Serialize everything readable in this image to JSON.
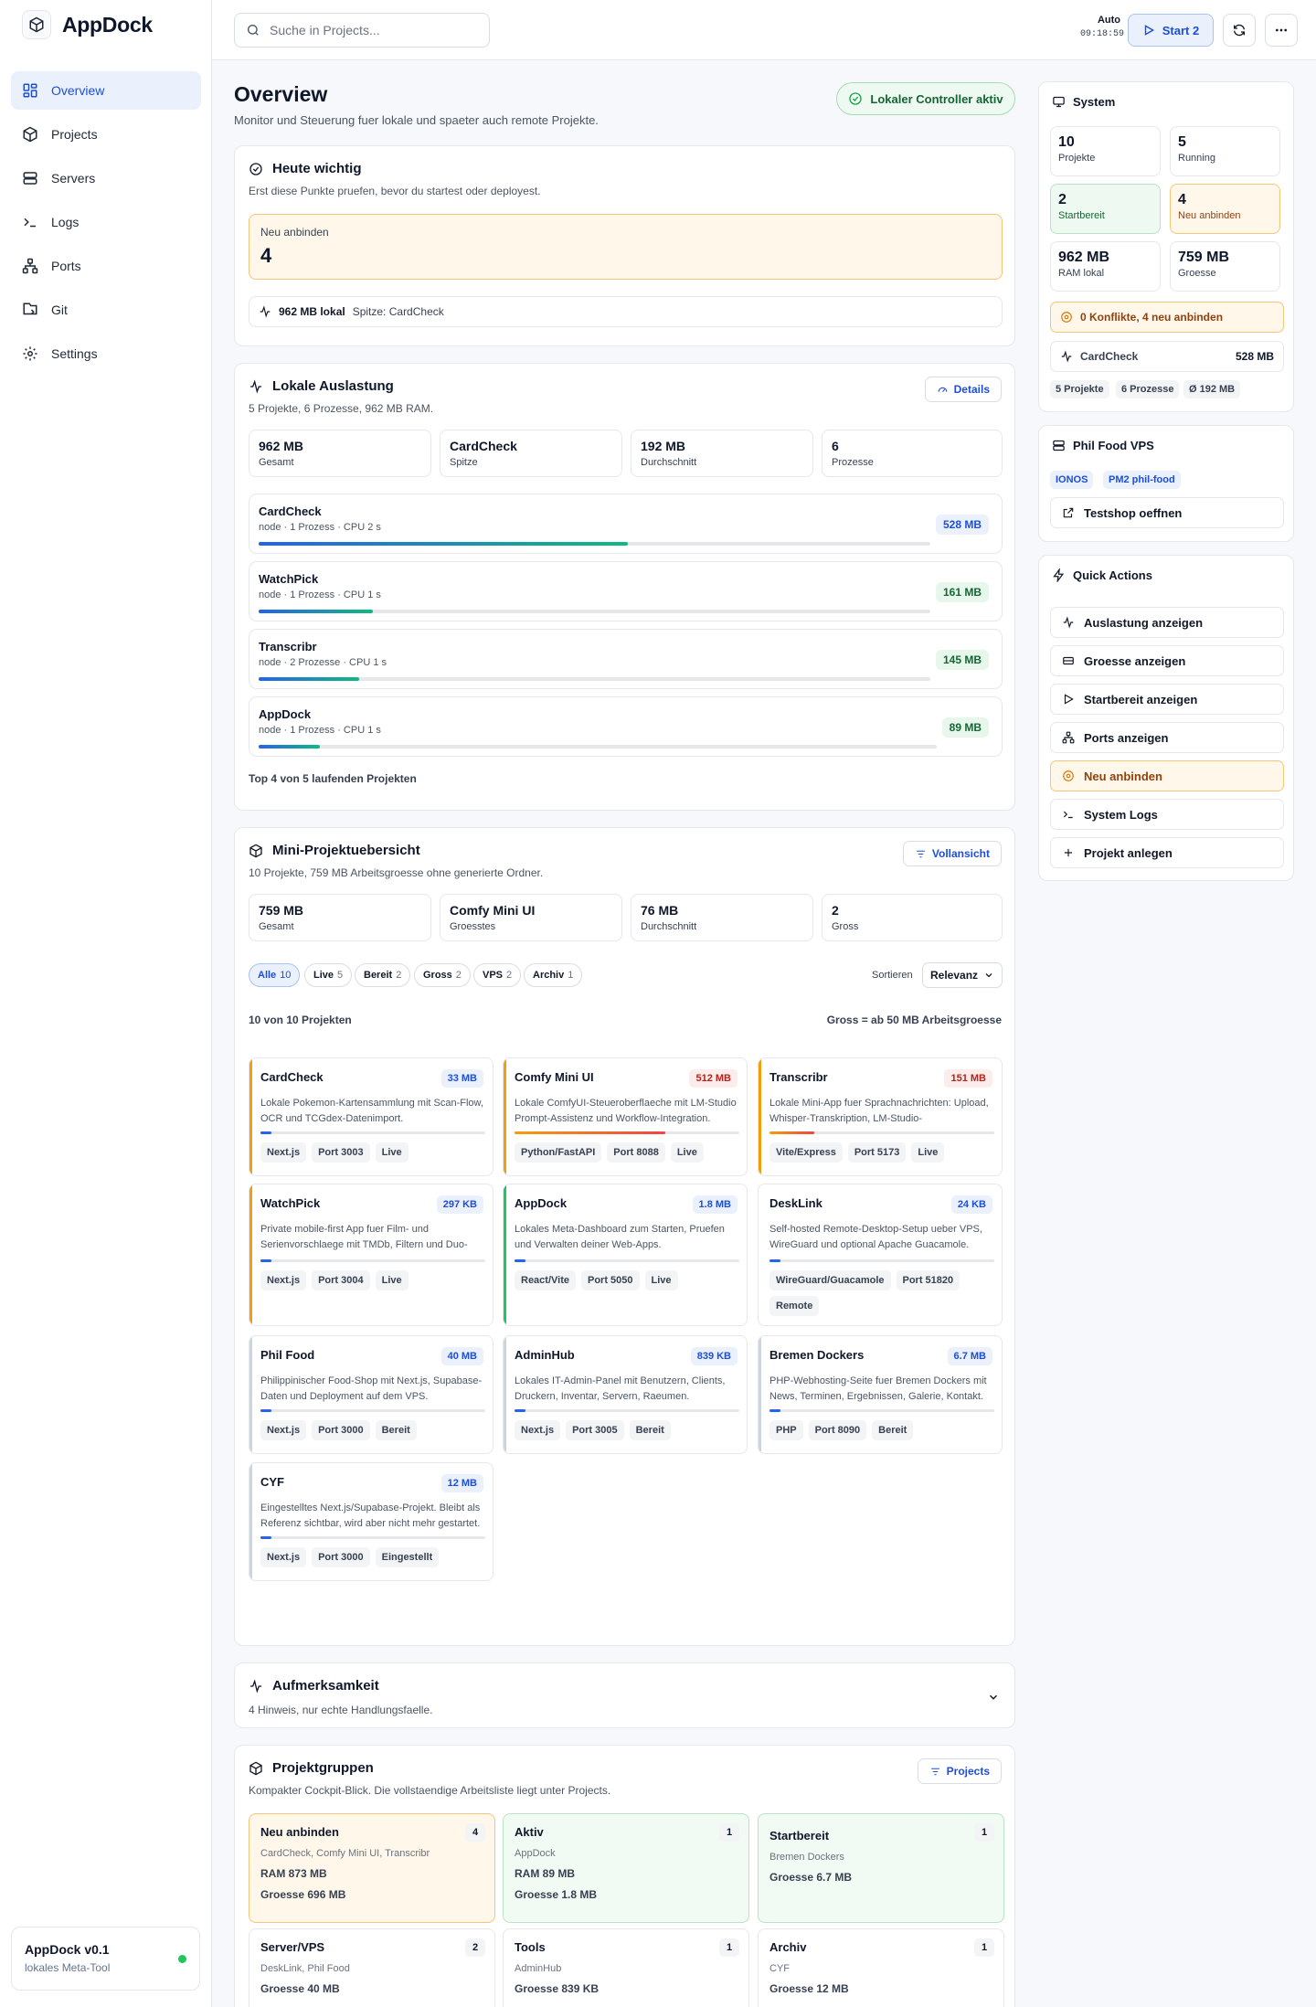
{
  "app": {
    "name": "AppDock",
    "version": "AppDock v0.1",
    "tagline": "lokales Meta-Tool"
  },
  "nav": [
    {
      "label": "Overview",
      "icon": "grid-icon",
      "active": true
    },
    {
      "label": "Projects",
      "icon": "cube-icon"
    },
    {
      "label": "Servers",
      "icon": "server-icon"
    },
    {
      "label": "Logs",
      "icon": "terminal-icon"
    },
    {
      "label": "Ports",
      "icon": "network-icon"
    },
    {
      "label": "Git",
      "icon": "git-icon"
    },
    {
      "label": "Settings",
      "icon": "gear-icon"
    }
  ],
  "topbar": {
    "search_placeholder": "Suche in Projects...",
    "mode": "Auto",
    "time": "09:18:59",
    "start_label": "Start 2"
  },
  "overview": {
    "title": "Overview",
    "subtitle": "Monitor und Steuerung fuer lokale und spaeter auch remote Projekte.",
    "controller": "Lokaler Controller aktiv"
  },
  "today": {
    "title": "Heute wichtig",
    "subtitle": "Erst diese Punkte pruefen, bevor du startest oder deployest.",
    "box_label": "Neu anbinden",
    "box_value": "4",
    "foot_ram": "962 MB lokal",
    "foot_peak": "Spitze: CardCheck"
  },
  "load": {
    "title": "Lokale Auslastung",
    "subtitle": "5 Projekte, 6 Prozesse, 962 MB RAM.",
    "details_label": "Details",
    "stats": [
      {
        "value": "962 MB",
        "label": "Gesamt"
      },
      {
        "value": "CardCheck",
        "label": "Spitze"
      },
      {
        "value": "192 MB",
        "label": "Durchschnitt"
      },
      {
        "value": "6",
        "label": "Prozesse"
      }
    ],
    "rows": [
      {
        "name": "CardCheck",
        "detail": "node · 1 Prozess · CPU 2 s",
        "mb": "528 MB",
        "fraction": 0.55
      },
      {
        "name": "WatchPick",
        "detail": "node · 1 Prozess · CPU 1 s",
        "mb": "161 MB",
        "fraction": 0.17
      },
      {
        "name": "Transcribr",
        "detail": "node · 2 Prozesse · CPU 1 s",
        "mb": "145 MB",
        "fraction": 0.15
      },
      {
        "name": "AppDock",
        "detail": "node · 1 Prozess · CPU 1 s",
        "mb": "89 MB",
        "fraction": 0.09
      }
    ],
    "footer": "Top 4 von 5 laufenden Projekten"
  },
  "mini": {
    "title": "Mini-Projektuebersicht",
    "subtitle": "10 Projekte, 759 MB Arbeitsgroesse ohne generierte Ordner.",
    "full_label": "Vollansicht",
    "stats": [
      {
        "value": "759 MB",
        "label": "Gesamt"
      },
      {
        "value": "Comfy Mini UI",
        "label": "Groesstes"
      },
      {
        "value": "76 MB",
        "label": "Durchschnitt"
      },
      {
        "value": "2",
        "label": "Gross"
      }
    ],
    "filters": [
      {
        "label": "Alle",
        "count": "10",
        "active": true
      },
      {
        "label": "Live",
        "count": "5"
      },
      {
        "label": "Bereit",
        "count": "2"
      },
      {
        "label": "Gross",
        "count": "2"
      },
      {
        "label": "VPS",
        "count": "2"
      },
      {
        "label": "Archiv",
        "count": "1"
      }
    ],
    "sort_label": "Sortieren",
    "sort_value": "Relevanz",
    "count_text": "10 von 10 Projekten",
    "gross_hint": "Gross = ab 50 MB Arbeitsgroesse",
    "projects": [
      {
        "name": "CardCheck",
        "size": "33 MB",
        "desc": "Lokale Pokemon-Kartensammlung mit Scan-Flow, OCR und TCGdex-Datenimport.",
        "tags": [
          "Next.js",
          "Port 3003",
          "Live"
        ],
        "fraction": 0.05,
        "accent": "#f59e0b",
        "fill": "#2563eb",
        "sizeColor": "blue"
      },
      {
        "name": "Comfy Mini UI",
        "size": "512 MB",
        "desc": "Lokale ComfyUI-Steueroberflaeche mit LM-Studio Prompt-Assistenz und Workflow-Integration.",
        "tags": [
          "Python/FastAPI",
          "Port 8088",
          "Live"
        ],
        "fraction": 0.67,
        "accent": "#f59e0b",
        "fill": "linear-gradient(90deg,#f59e0b,#ef4444)",
        "sizeColor": "red"
      },
      {
        "name": "Transcribr",
        "size": "151 MB",
        "desc": "Lokale Mini-App fuer Sprachnachrichten: Upload, Whisper-Transkription, LM-Studio-Zusammenfassung.",
        "tags": [
          "Vite/Express",
          "Port 5173",
          "Live"
        ],
        "fraction": 0.2,
        "accent": "#f59e0b",
        "fill": "linear-gradient(90deg,#f59e0b,#ef4444)",
        "sizeColor": "red"
      },
      {
        "name": "WatchPick",
        "size": "297 KB",
        "desc": "Private mobile-first App fuer Film- und Serienvorschlaege mit TMDb, Filtern und Duo-Modus.",
        "tags": [
          "Next.js",
          "Port 3004",
          "Live"
        ],
        "fraction": 0.05,
        "accent": "#f59e0b",
        "fill": "#2563eb",
        "sizeColor": "blue"
      },
      {
        "name": "AppDock",
        "size": "1.8 MB",
        "desc": "Lokales Meta-Dashboard zum Starten, Pruefen und Verwalten deiner Web-Apps.",
        "tags": [
          "React/Vite",
          "Port 5050",
          "Live"
        ],
        "fraction": 0.05,
        "accent": "#22c55e",
        "fill": "#2563eb",
        "sizeColor": "blue"
      },
      {
        "name": "DeskLink",
        "size": "24 KB",
        "desc": "Self-hosted Remote-Desktop-Setup ueber VPS, WireGuard und optional Apache Guacamole.",
        "tags": [
          "WireGuard/Guacamole",
          "Port 51820",
          "Remote"
        ],
        "fraction": 0.05,
        "accent": "",
        "fill": "#2563eb",
        "sizeColor": "blue"
      },
      {
        "name": "Phil Food",
        "size": "40 MB",
        "desc": "Philippinischer Food-Shop mit Next.js, Supabase-Daten und Deployment auf dem VPS.",
        "tags": [
          "Next.js",
          "Port 3000",
          "Bereit"
        ],
        "fraction": 0.05,
        "accent": "#cbd5e1",
        "fill": "#2563eb",
        "sizeColor": "blue"
      },
      {
        "name": "AdminHub",
        "size": "839 KB",
        "desc": "Lokales IT-Admin-Panel mit Benutzern, Clients, Druckern, Inventar, Servern, Raeumen.",
        "tags": [
          "Next.js",
          "Port 3005",
          "Bereit"
        ],
        "fraction": 0.05,
        "accent": "#cbd5e1",
        "fill": "#2563eb",
        "sizeColor": "blue"
      },
      {
        "name": "Bremen Dockers",
        "size": "6.7 MB",
        "desc": "PHP-Webhosting-Seite fuer Bremen Dockers mit News, Terminen, Ergebnissen, Galerie, Kontakt.",
        "tags": [
          "PHP",
          "Port 8090",
          "Bereit"
        ],
        "fraction": 0.05,
        "accent": "#cbd5e1",
        "fill": "#2563eb",
        "sizeColor": "blue"
      },
      {
        "name": "CYF",
        "size": "12 MB",
        "desc": "Eingestelltes Next.js/Supabase-Projekt. Bleibt als Referenz sichtbar, wird aber nicht mehr gestartet.",
        "tags": [
          "Next.js",
          "Port 3000",
          "Eingestellt"
        ],
        "fraction": 0.05,
        "accent": "#cbd5e1",
        "fill": "#2563eb",
        "sizeColor": "blue"
      }
    ]
  },
  "attention": {
    "title": "Aufmerksamkeit",
    "subtitle": "4 Hinweis, nur echte Handlungsfaelle."
  },
  "groups": {
    "title": "Projektgruppen",
    "subtitle": "Kompakter Cockpit-Blick. Die vollstaendige Arbeitsliste liegt unter Projects.",
    "button": "Projects",
    "items": [
      {
        "name": "Neu anbinden",
        "count": "4",
        "projects": "CardCheck, Comfy Mini UI, Transcribr",
        "ram": "RAM 873 MB",
        "size": "Groesse 696 MB",
        "tone": "orange"
      },
      {
        "name": "Aktiv",
        "count": "1",
        "projects": "AppDock",
        "ram": "RAM 89 MB",
        "size": "Groesse 1.8 MB",
        "tone": "green"
      },
      {
        "name": "Startbereit",
        "count": "1",
        "projects": "Bremen Dockers",
        "ram": "",
        "size": "Groesse 6.7 MB",
        "tone": "green"
      },
      {
        "name": "Server/VPS",
        "count": "2",
        "projects": "DeskLink, Phil Food",
        "ram": "",
        "size": "Groesse 40 MB",
        "tone": ""
      },
      {
        "name": "Tools",
        "count": "1",
        "projects": "AdminHub",
        "ram": "",
        "size": "Groesse 839 KB",
        "tone": ""
      },
      {
        "name": "Archiv",
        "count": "1",
        "projects": "CYF",
        "ram": "",
        "size": "Groesse 12 MB",
        "tone": ""
      }
    ]
  },
  "system": {
    "title": "System",
    "stats": [
      {
        "value": "10",
        "label": "Projekte",
        "tone": ""
      },
      {
        "value": "5",
        "label": "Running",
        "tone": ""
      },
      {
        "value": "2",
        "label": "Startbereit",
        "tone": "green"
      },
      {
        "value": "4",
        "label": "Neu anbinden",
        "tone": "orange"
      },
      {
        "value": "962 MB",
        "label": "RAM lokal",
        "tone": ""
      },
      {
        "value": "759 MB",
        "label": "Groesse",
        "tone": ""
      }
    ],
    "conflicts": "0 Konflikte, 4 neu anbinden",
    "peak_name": "CardCheck",
    "peak_mb": "528 MB",
    "mini": [
      "5 Projekte",
      "6 Prozesse",
      "Ø 192 MB"
    ]
  },
  "vps": {
    "title": "Phil Food VPS",
    "badges": [
      "IONOS",
      "PM2 phil-food"
    ],
    "action": "Testshop oeffnen"
  },
  "quick": {
    "title": "Quick Actions",
    "actions": [
      {
        "label": "Auslastung anzeigen",
        "icon": "activity-icon"
      },
      {
        "label": "Groesse anzeigen",
        "icon": "drive-icon"
      },
      {
        "label": "Startbereit anzeigen",
        "icon": "play-icon"
      },
      {
        "label": "Ports anzeigen",
        "icon": "network-icon"
      },
      {
        "label": "Neu anbinden",
        "icon": "target-icon",
        "warn": true
      },
      {
        "label": "System Logs",
        "icon": "terminal-icon"
      },
      {
        "label": "Projekt anlegen",
        "icon": "plus-icon"
      }
    ]
  },
  "colors": {
    "accent": "#1d4ed8",
    "success": "#166534",
    "warning": "#f59e0b",
    "danger": "#b42318"
  }
}
